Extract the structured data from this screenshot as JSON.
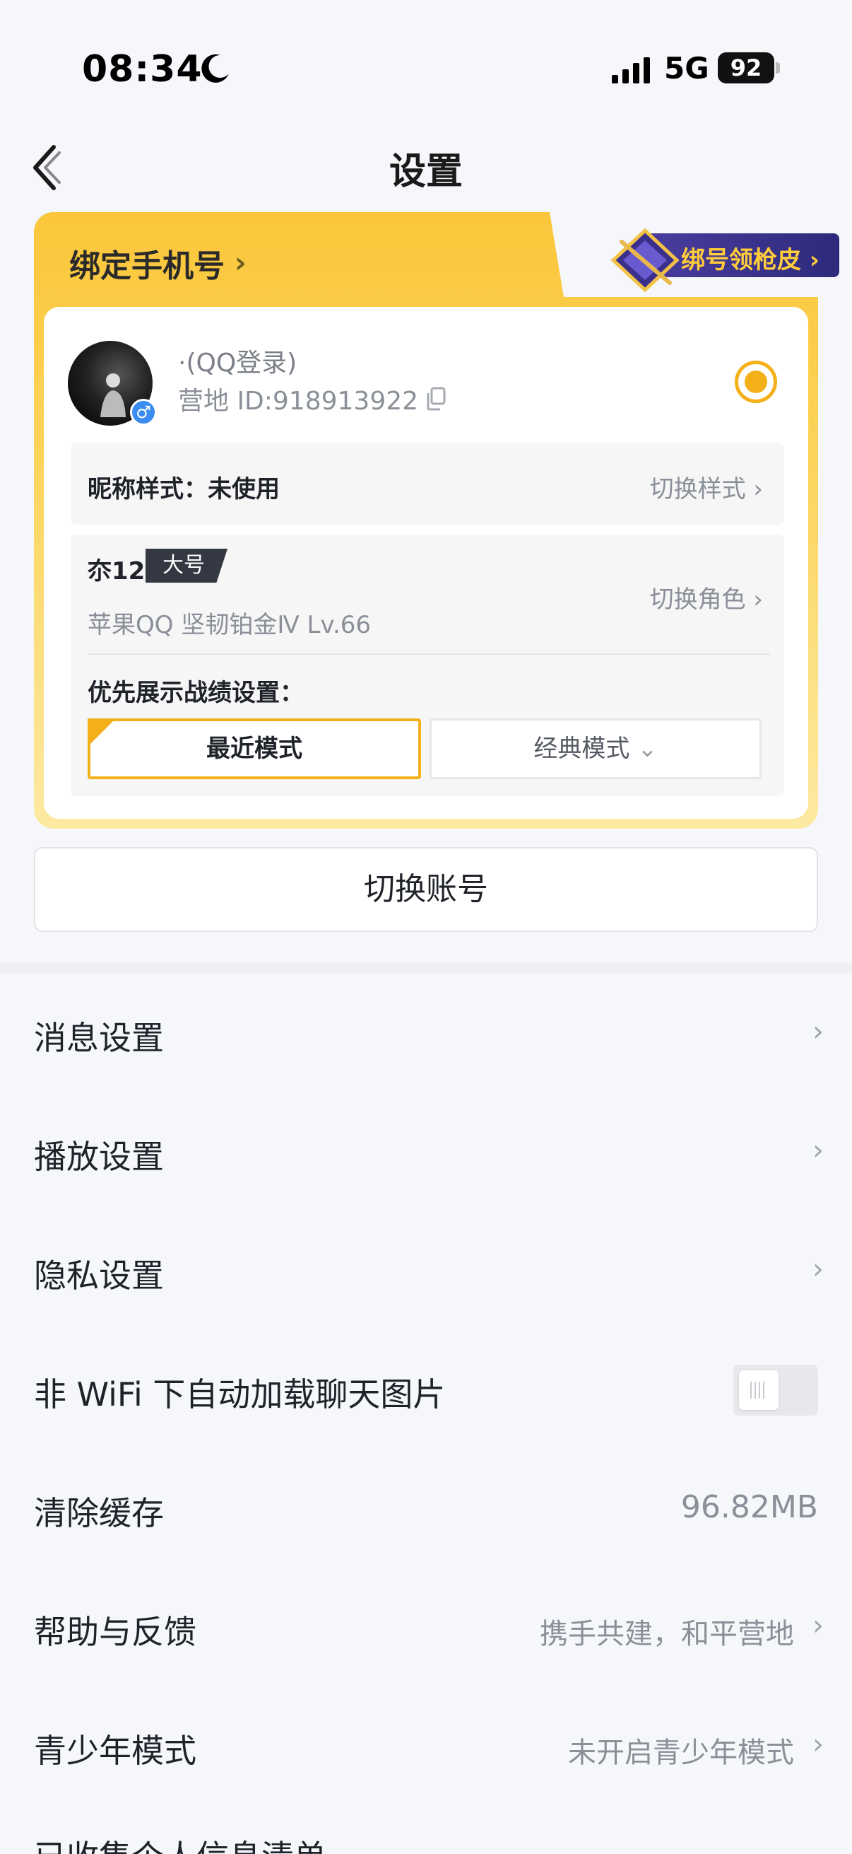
{
  "status_bar": {
    "time": "08:34",
    "network": "5G",
    "battery": "92"
  },
  "header": {
    "title": "设置"
  },
  "account_card": {
    "bind_phone": "绑定手机号",
    "bind_badge": "绑号领枪皮",
    "login_type": "·(QQ登录)",
    "camp_id": "营地 ID:918913922",
    "gender": "♂",
    "nickname_style": "昵称样式：未使用",
    "nickname_switch": "切换样式",
    "role_name": "夵12",
    "role_tag": "大号",
    "role_info": "苹果QQ  坚韧铂金Ⅳ  Lv.66",
    "role_switch": "切换角色",
    "pref_label": "优先展示战绩设置：",
    "mode_recent": "最近模式",
    "mode_classic": "经典模式"
  },
  "switch_account": "切换账号",
  "settings": {
    "items": [
      {
        "label": "消息设置",
        "value": ""
      },
      {
        "label": "播放设置",
        "value": ""
      },
      {
        "label": "隐私设置",
        "value": ""
      },
      {
        "label": "非 WiFi 下自动加载聊天图片",
        "value": ""
      },
      {
        "label": "清除缓存",
        "value": "96.82MB"
      },
      {
        "label": "帮助与反馈",
        "value": "携手共建，和平营地"
      },
      {
        "label": "青少年模式",
        "value": "未开启青少年模式"
      }
    ],
    "wifi_autoload_enabled": false
  },
  "partial_row": "已收集个人信息清单",
  "colors": {
    "accent": "#f4b018",
    "background": "#f5f7fb"
  }
}
